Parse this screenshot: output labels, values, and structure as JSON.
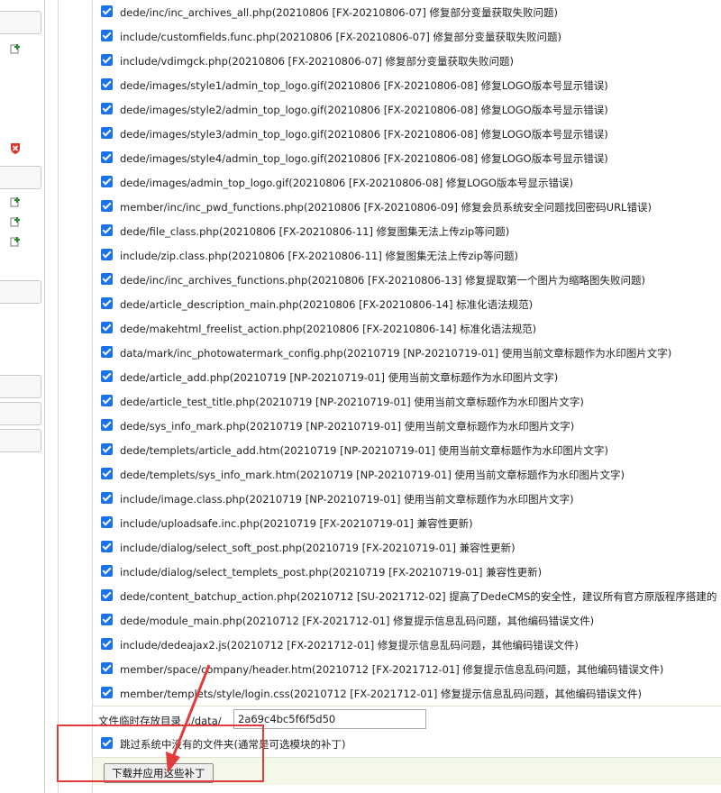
{
  "sidebar": {
    "bars": [
      {
        "name": "side-bar-1"
      },
      {
        "name": "side-bar-2"
      },
      {
        "name": "side-bar-3"
      },
      {
        "name": "side-bar-4"
      },
      {
        "name": "side-bar-5"
      },
      {
        "name": "side-bar-6"
      }
    ],
    "icons": [
      {
        "name": "add-item-icon",
        "color": "#2e8b2e"
      },
      {
        "name": "delete-shield-icon",
        "color": "#d9362b"
      },
      {
        "name": "add-item-icon",
        "color": "#2e8b2e"
      },
      {
        "name": "add-item-icon",
        "color": "#2e8b2e"
      },
      {
        "name": "add-item-icon",
        "color": "#2e8b2e"
      }
    ]
  },
  "patch_files": [
    {
      "checked": true,
      "label": "dede/inc/inc_archives_all.php(20210806 [FX-20210806-07] 修复部分变量获取失败问题)"
    },
    {
      "checked": true,
      "label": "include/customfields.func.php(20210806 [FX-20210806-07] 修复部分变量获取失败问题)"
    },
    {
      "checked": true,
      "label": "include/vdimgck.php(20210806 [FX-20210806-07] 修复部分变量获取失败问题)"
    },
    {
      "checked": true,
      "label": "dede/images/style1/admin_top_logo.gif(20210806 [FX-20210806-08] 修复LOGO版本号显示错误)"
    },
    {
      "checked": true,
      "label": "dede/images/style2/admin_top_logo.gif(20210806 [FX-20210806-08] 修复LOGO版本号显示错误)"
    },
    {
      "checked": true,
      "label": "dede/images/style3/admin_top_logo.gif(20210806 [FX-20210806-08] 修复LOGO版本号显示错误)"
    },
    {
      "checked": true,
      "label": "dede/images/style4/admin_top_logo.gif(20210806 [FX-20210806-08] 修复LOGO版本号显示错误)"
    },
    {
      "checked": true,
      "label": "dede/images/admin_top_logo.gif(20210806 [FX-20210806-08] 修复LOGO版本号显示错误)"
    },
    {
      "checked": true,
      "label": "member/inc/inc_pwd_functions.php(20210806 [FX-20210806-09] 修复会员系统安全问题找回密码URL错误)"
    },
    {
      "checked": true,
      "label": "dede/file_class.php(20210806 [FX-20210806-11] 修复图集无法上传zip等问题)"
    },
    {
      "checked": true,
      "label": "include/zip.class.php(20210806 [FX-20210806-11] 修复图集无法上传zip等问题)"
    },
    {
      "checked": true,
      "label": "dede/inc/inc_archives_functions.php(20210806 [FX-20210806-13] 修复提取第一个图片为缩略图失败问题)"
    },
    {
      "checked": true,
      "label": "dede/article_description_main.php(20210806 [FX-20210806-14] 标准化语法规范)"
    },
    {
      "checked": true,
      "label": "dede/makehtml_freelist_action.php(20210806 [FX-20210806-14] 标准化语法规范)"
    },
    {
      "checked": true,
      "label": "data/mark/inc_photowatermark_config.php(20210719 [NP-20210719-01] 使用当前文章标题作为水印图片文字)"
    },
    {
      "checked": true,
      "label": "dede/article_add.php(20210719 [NP-20210719-01] 使用当前文章标题作为水印图片文字)"
    },
    {
      "checked": true,
      "label": "dede/article_test_title.php(20210719 [NP-20210719-01] 使用当前文章标题作为水印图片文字)"
    },
    {
      "checked": true,
      "label": "dede/sys_info_mark.php(20210719 [NP-20210719-01] 使用当前文章标题作为水印图片文字)"
    },
    {
      "checked": true,
      "label": "dede/templets/article_add.htm(20210719 [NP-20210719-01] 使用当前文章标题作为水印图片文字)"
    },
    {
      "checked": true,
      "label": "dede/templets/sys_info_mark.htm(20210719 [NP-20210719-01] 使用当前文章标题作为水印图片文字)"
    },
    {
      "checked": true,
      "label": "include/image.class.php(20210719 [NP-20210719-01] 使用当前文章标题作为水印图片文字)"
    },
    {
      "checked": true,
      "label": "include/uploadsafe.inc.php(20210719 [FX-20210719-01] 兼容性更新)"
    },
    {
      "checked": true,
      "label": "include/dialog/select_soft_post.php(20210719 [FX-20210719-01] 兼容性更新)"
    },
    {
      "checked": true,
      "label": "include/dialog/select_templets_post.php(20210719 [FX-20210719-01] 兼容性更新)"
    },
    {
      "checked": true,
      "label": "dede/content_batchup_action.php(20210712 [SU-2021712-02] 提高了DedeCMS的安全性，建议所有官方原版程序搭建的"
    },
    {
      "checked": true,
      "label": "dede/module_main.php(20210712 [FX-2021712-01] 修复提示信息乱码问题，其他编码错误文件)"
    },
    {
      "checked": true,
      "label": "include/dedeajax2.js(20210712 [FX-2021712-01] 修复提示信息乱码问题，其他编码错误文件)"
    },
    {
      "checked": true,
      "label": "member/space/company/header.htm(20210712 [FX-2021712-01] 修复提示信息乱码问题，其他编码错误文件)"
    },
    {
      "checked": true,
      "label": "member/templets/style/login.css(20210712 [FX-2021712-01] 修复提示信息乱码问题，其他编码错误文件)"
    }
  ],
  "temp_dir": {
    "label": "文件临时存放目录 ../data/",
    "value": "2a69c4bc5f6f5d50"
  },
  "skip": {
    "checked": true,
    "label": "跳过系统中没有的文件夹(通常是可选模块的补丁)"
  },
  "apply_button": "下载并应用这些补丁",
  "colors": {
    "checkbox": "#1a73e8",
    "annotation": "#e23b3b",
    "footer_bg": "#f4f8e8"
  }
}
